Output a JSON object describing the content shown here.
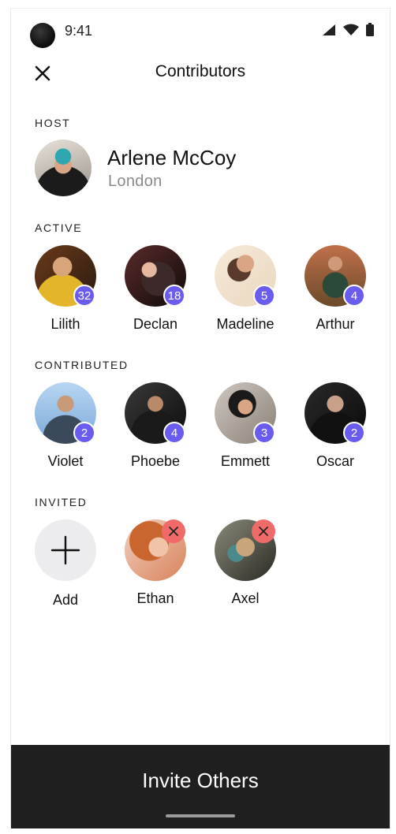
{
  "status_bar": {
    "time": "9:41"
  },
  "header": {
    "title": "Contributors",
    "close_icon": "close-icon"
  },
  "host": {
    "label": "HOST",
    "name": "Arlene McCoy",
    "city": "London"
  },
  "active": {
    "label": "ACTIVE",
    "people": [
      {
        "name": "Lilith",
        "count": "32",
        "colors": [
          "#c48a2a",
          "#2a1a10"
        ]
      },
      {
        "name": "Declan",
        "count": "18",
        "colors": [
          "#3a2a26",
          "#0f0b0a"
        ]
      },
      {
        "name": "Madeline",
        "count": "5",
        "colors": [
          "#f1dfc9",
          "#5a3a2c"
        ]
      },
      {
        "name": "Arthur",
        "count": "4",
        "colors": [
          "#b27a4e",
          "#2b3a2a"
        ]
      }
    ]
  },
  "contributed": {
    "label": "CONTRIBUTED",
    "people": [
      {
        "name": "Violet",
        "count": "2",
        "colors": [
          "#9cc3ea",
          "#3a2a20"
        ]
      },
      {
        "name": "Phoebe",
        "count": "4",
        "colors": [
          "#3a3a3a",
          "#0c0c0c"
        ]
      },
      {
        "name": "Emmett",
        "count": "3",
        "colors": [
          "#b9b1a8",
          "#2a2420"
        ]
      },
      {
        "name": "Oscar",
        "count": "2",
        "colors": [
          "#2a2a2a",
          "#0a0a0a"
        ]
      }
    ]
  },
  "invited": {
    "label": "INVITED",
    "add_label": "Add",
    "people": [
      {
        "name": "Ethan",
        "colors": [
          "#d9825a",
          "#a04a2a"
        ]
      },
      {
        "name": "Axel",
        "colors": [
          "#6a7a6a",
          "#2a2a24"
        ]
      }
    ]
  },
  "footer": {
    "invite_label": "Invite Others"
  },
  "colors": {
    "badge": "#6b5cf0",
    "remove": "#f06a6a",
    "footer": "#1f1f1f"
  }
}
